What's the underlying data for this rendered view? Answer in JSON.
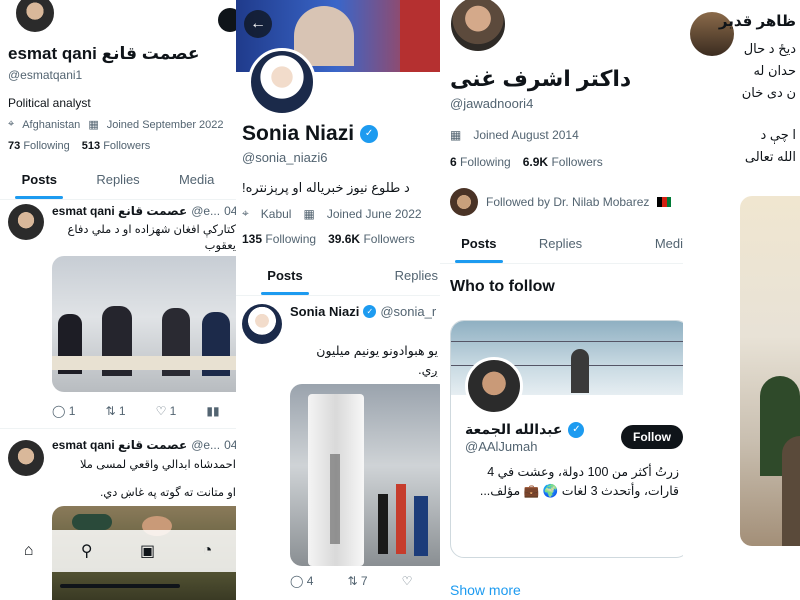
{
  "panel1": {
    "display_name": "esmat qani عصمت قانع",
    "handle": "@esmatqani1",
    "bio": "Political analyst",
    "location": "Afghanistan",
    "joined": "Joined September 2022",
    "following_count": "73",
    "following_label": "Following",
    "followers_count": "513",
    "followers_label": "Followers",
    "tabs": [
      "Posts",
      "Replies",
      "Media"
    ],
    "tweet1": {
      "author": "esmat qani عصمت قانع",
      "handle": "@e...",
      "date": "04",
      "text_line1": "کتارکې افغان شهزاده او د ملي دفاع",
      "text_line2": "یعقوب",
      "replies": "1",
      "retweets": "1",
      "likes": "1"
    },
    "tweet2": {
      "author": "esmat qani عصمت قانع",
      "handle": "@e...",
      "date": "04",
      "text_line1": "احمدشاه ابدالي واقعي لمسی ملا",
      "text_line2": "او متانت ته گوته په غاښ دي."
    }
  },
  "panel2": {
    "display_name": "Sonia Niazi",
    "handle": "@sonia_niazi6",
    "bio": "د طلوع نیوز خبریاله او پرېزنتره!",
    "location": "Kabul",
    "joined": "Joined June 2022",
    "following_count": "135",
    "following_label": "Following",
    "followers_count": "39.6K",
    "followers_label": "Followers",
    "tabs": [
      "Posts",
      "Replies"
    ],
    "tweet": {
      "author": "Sonia Niazi",
      "handle": "@sonia_r",
      "text_line1": "یو هبوادونو یونیم میلیون",
      "text_line2": "ږي.",
      "replies": "4",
      "retweets": "7"
    }
  },
  "panel3": {
    "display_name": "داکتر اشرف غنی",
    "handle": "@jawadnoori4",
    "joined": "Joined August 2014",
    "following_count": "6",
    "following_label": "Following",
    "followers_count": "6.9K",
    "followers_label": "Followers",
    "followed_by": "Followed by Dr. Nilab Mobarez",
    "tabs": [
      "Posts",
      "Replies",
      "Medi"
    ],
    "who_to_follow": "Who to follow",
    "suggest": {
      "name": "عبدالله الجمعة",
      "handle": "@AAlJumah",
      "follow_label": "Follow",
      "bio_line1": "زرتُ أكثر من 100 دولة، وعشت في 4",
      "bio_line2": "قارات، وأتحدث 3 لغات 🌍 💼 مؤلف..."
    },
    "show_more": "Show more"
  },
  "panel4": {
    "name": "ظاهر قدير",
    "lines": [
      "ديځ د حال",
      "حدان له",
      "ن دی خان",
      "ا چې د",
      "الله تعالی"
    ]
  },
  "bottom_nav": [
    "home-icon",
    "search-icon",
    "compose-icon",
    "notifications-icon"
  ],
  "colors": {
    "accent": "#1d9bf0",
    "text": "#0f1419",
    "muted": "#536471"
  }
}
